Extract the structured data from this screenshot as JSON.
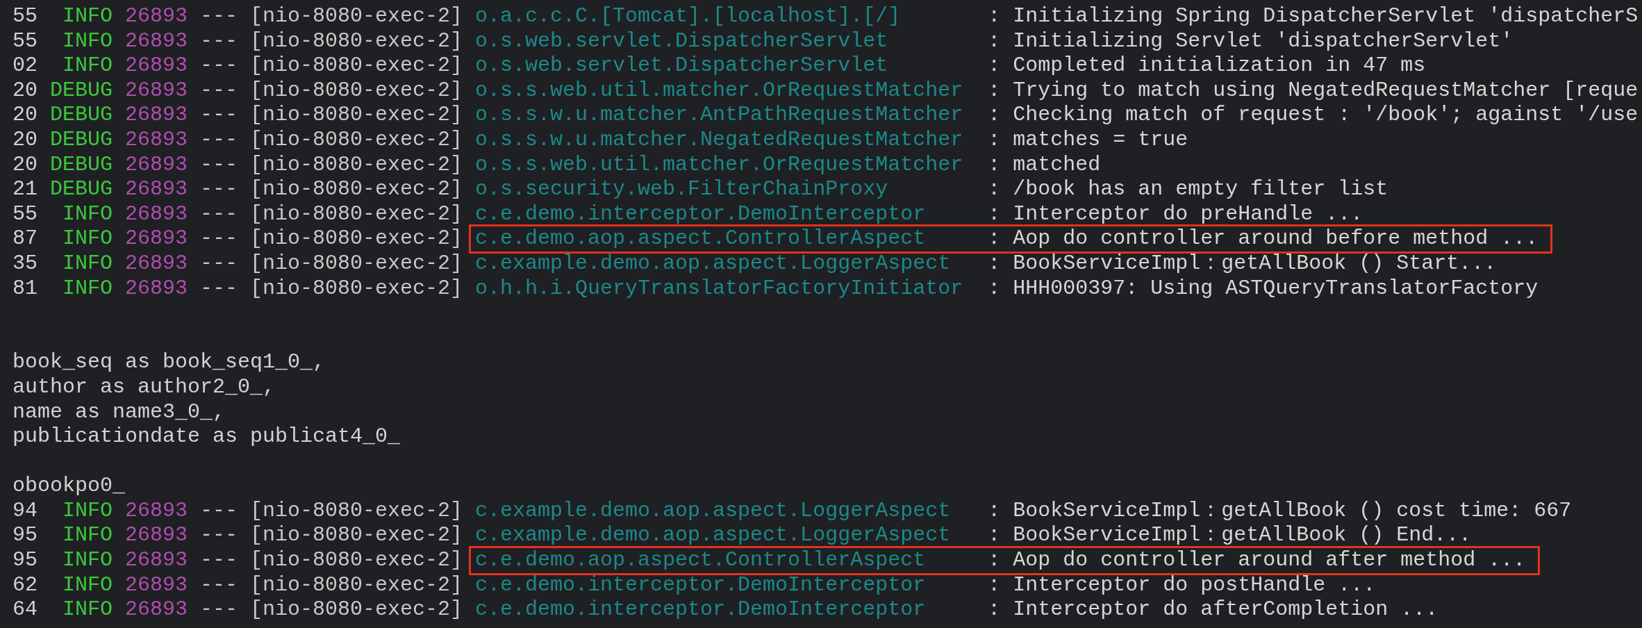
{
  "terminal": {
    "lines": [
      {
        "kind": "log",
        "time": "55",
        "level": "INFO",
        "pid": "26893",
        "sep": "---",
        "thread": "[nio-8080-exec-2]",
        "logger": "o.a.c.c.C.[Tomcat].[localhost].[/]",
        "colon": ":",
        "message": "Initializing Spring DispatcherServlet 'dispatcherS",
        "highlighted": false
      },
      {
        "kind": "log",
        "time": "55",
        "level": "INFO",
        "pid": "26893",
        "sep": "---",
        "thread": "[nio-8080-exec-2]",
        "logger": "o.s.web.servlet.DispatcherServlet",
        "colon": ":",
        "message": "Initializing Servlet 'dispatcherServlet'",
        "highlighted": false
      },
      {
        "kind": "log",
        "time": "02",
        "level": "INFO",
        "pid": "26893",
        "sep": "---",
        "thread": "[nio-8080-exec-2]",
        "logger": "o.s.web.servlet.DispatcherServlet",
        "colon": ":",
        "message": "Completed initialization in 47 ms",
        "highlighted": false
      },
      {
        "kind": "log",
        "time": "20",
        "level": "DEBUG",
        "pid": "26893",
        "sep": "---",
        "thread": "[nio-8080-exec-2]",
        "logger": "o.s.s.web.util.matcher.OrRequestMatcher",
        "colon": ":",
        "message": "Trying to match using NegatedRequestMatcher [reque",
        "highlighted": false
      },
      {
        "kind": "log",
        "time": "20",
        "level": "DEBUG",
        "pid": "26893",
        "sep": "---",
        "thread": "[nio-8080-exec-2]",
        "logger": "o.s.s.w.u.matcher.AntPathRequestMatcher",
        "colon": ":",
        "message": "Checking match of request : '/book'; against '/use",
        "highlighted": false
      },
      {
        "kind": "log",
        "time": "20",
        "level": "DEBUG",
        "pid": "26893",
        "sep": "---",
        "thread": "[nio-8080-exec-2]",
        "logger": "o.s.s.w.u.matcher.NegatedRequestMatcher",
        "colon": ":",
        "message": "matches = true",
        "highlighted": false
      },
      {
        "kind": "log",
        "time": "20",
        "level": "DEBUG",
        "pid": "26893",
        "sep": "---",
        "thread": "[nio-8080-exec-2]",
        "logger": "o.s.s.web.util.matcher.OrRequestMatcher",
        "colon": ":",
        "message": "matched",
        "highlighted": false
      },
      {
        "kind": "log",
        "time": "21",
        "level": "DEBUG",
        "pid": "26893",
        "sep": "---",
        "thread": "[nio-8080-exec-2]",
        "logger": "o.s.security.web.FilterChainProxy",
        "colon": ":",
        "message": "/book has an empty filter list",
        "highlighted": false
      },
      {
        "kind": "log",
        "time": "55",
        "level": "INFO",
        "pid": "26893",
        "sep": "---",
        "thread": "[nio-8080-exec-2]",
        "logger": "c.e.demo.interceptor.DemoInterceptor",
        "colon": ":",
        "message": "Interceptor do preHandle ...",
        "highlighted": false
      },
      {
        "kind": "log",
        "time": "87",
        "level": "INFO",
        "pid": "26893",
        "sep": "---",
        "thread": "[nio-8080-exec-2]",
        "logger": "c.e.demo.aop.aspect.ControllerAspect",
        "colon": ":",
        "message": "Aop do controller around before method ...",
        "highlighted": true
      },
      {
        "kind": "log",
        "time": "35",
        "level": "INFO",
        "pid": "26893",
        "sep": "---",
        "thread": "[nio-8080-exec-2]",
        "logger": "c.example.demo.aop.aspect.LoggerAspect",
        "colon": ":",
        "message": "BookServiceImpl：getAllBook () Start...",
        "highlighted": false
      },
      {
        "kind": "log",
        "time": "81",
        "level": "INFO",
        "pid": "26893",
        "sep": "---",
        "thread": "[nio-8080-exec-2]",
        "logger": "o.h.h.i.QueryTranslatorFactoryInitiator",
        "colon": ":",
        "message": "HHH000397: Using ASTQueryTranslatorFactory",
        "highlighted": false
      },
      {
        "kind": "blank"
      },
      {
        "kind": "blank"
      },
      {
        "kind": "text",
        "text": "book_seq as book_seq1_0_,"
      },
      {
        "kind": "text",
        "text": "author as author2_0_,"
      },
      {
        "kind": "text",
        "text": "name as name3_0_,"
      },
      {
        "kind": "text",
        "text": "publicationdate as publicat4_0_"
      },
      {
        "kind": "blank"
      },
      {
        "kind": "text",
        "text": "obookpo0_"
      },
      {
        "kind": "log",
        "time": "94",
        "level": "INFO",
        "pid": "26893",
        "sep": "---",
        "thread": "[nio-8080-exec-2]",
        "logger": "c.example.demo.aop.aspect.LoggerAspect",
        "colon": ":",
        "message": "BookServiceImpl：getAllBook () cost time: 667",
        "highlighted": false
      },
      {
        "kind": "log",
        "time": "95",
        "level": "INFO",
        "pid": "26893",
        "sep": "---",
        "thread": "[nio-8080-exec-2]",
        "logger": "c.example.demo.aop.aspect.LoggerAspect",
        "colon": ":",
        "message": "BookServiceImpl：getAllBook () End...",
        "highlighted": false
      },
      {
        "kind": "log",
        "time": "95",
        "level": "INFO",
        "pid": "26893",
        "sep": "---",
        "thread": "[nio-8080-exec-2]",
        "logger": "c.e.demo.aop.aspect.ControllerAspect",
        "colon": ":",
        "message": "Aop do controller around after method ...",
        "highlighted": true
      },
      {
        "kind": "log",
        "time": "62",
        "level": "INFO",
        "pid": "26893",
        "sep": "---",
        "thread": "[nio-8080-exec-2]",
        "logger": "c.e.demo.interceptor.DemoInterceptor",
        "colon": ":",
        "message": "Interceptor do postHandle ...",
        "highlighted": false
      },
      {
        "kind": "log",
        "time": "64",
        "level": "INFO",
        "pid": "26893",
        "sep": "---",
        "thread": "[nio-8080-exec-2]",
        "logger": "c.e.demo.interceptor.DemoInterceptor",
        "colon": ":",
        "message": "Interceptor do afterCompletion ...",
        "highlighted": false
      }
    ]
  }
}
